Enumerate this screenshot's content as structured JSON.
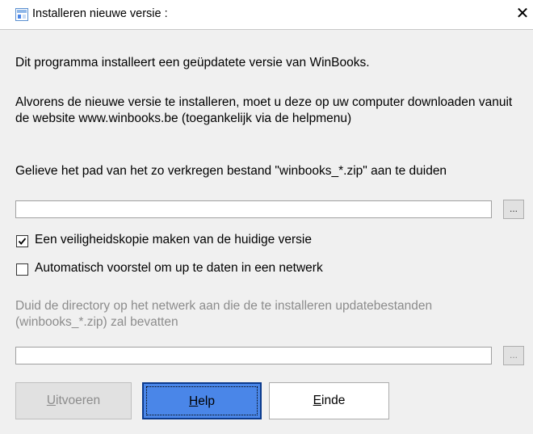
{
  "window": {
    "title": "Installeren nieuwe versie :",
    "close_label": "✕"
  },
  "dialog": {
    "intro": "Dit programma installeert een geüpdatete versie van WinBooks.",
    "instructions": "Alvorens de nieuwe versie te installeren, moet u deze op uw computer downloaden vanuit de website www.winbooks.be (toegankelijk via de helpmenu)",
    "path_prompt": "Gelieve het pad van het zo verkregen bestand \"winbooks_*.zip\" aan te duiden",
    "path_value": "",
    "browse_label": "...",
    "backup_checkbox": {
      "label": "Een veiligheidskopie maken van de huidige versie",
      "checked": true
    },
    "network_checkbox": {
      "label": "Automatisch voorstel om up te daten in een netwerk",
      "checked": false
    },
    "network_prompt": "Duid de directory op het netwerk aan die de te installeren updatebestanden (winbooks_*.zip) zal bevatten",
    "network_path_value": "",
    "network_browse_label": "..."
  },
  "buttons": {
    "run": {
      "first": "U",
      "rest": "itvoeren"
    },
    "help": {
      "first": "H",
      "rest": "elp"
    },
    "end": {
      "first": "E",
      "rest": "inde"
    }
  }
}
